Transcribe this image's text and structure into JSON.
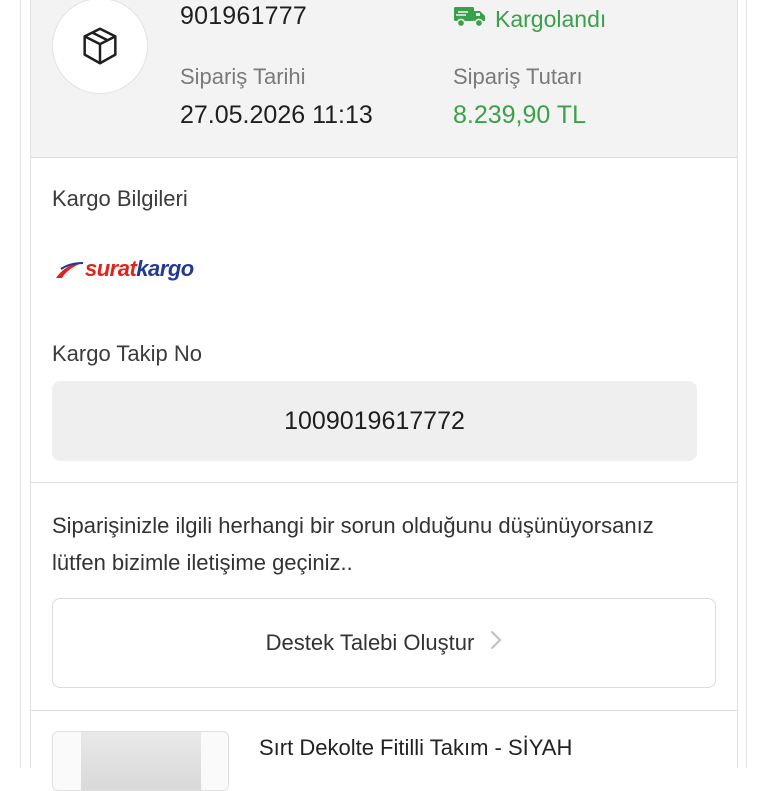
{
  "order": {
    "number": "901961777",
    "status": "Kargolandı",
    "date_label": "Sipariş Tarihi",
    "date_value": "27.05.2026 11:13",
    "amount_label": "Sipariş Tutarı",
    "amount_value": "8.239,90 TL"
  },
  "cargo": {
    "title": "Kargo Bilgileri",
    "logo_part1": "surat",
    "logo_part2": "kargo",
    "tracking_label": "Kargo Takip No",
    "tracking_number": "1009019617772"
  },
  "support": {
    "message": "Siparişinizle ilgili herhangi bir sorun olduğunu düşünüyorsanız lütfen bizimle iletişime geçiniz..",
    "button_label": "Destek Talebi Oluştur"
  },
  "product": {
    "name": "Sırt Dekolte Fitilli Takım - SİYAH"
  },
  "colors": {
    "success": "#3aa14a",
    "logo_red": "#e2231a",
    "logo_blue": "#233a93"
  },
  "icons": {
    "order": "package-icon",
    "status": "truck-icon",
    "button": "chevron-right-icon"
  }
}
